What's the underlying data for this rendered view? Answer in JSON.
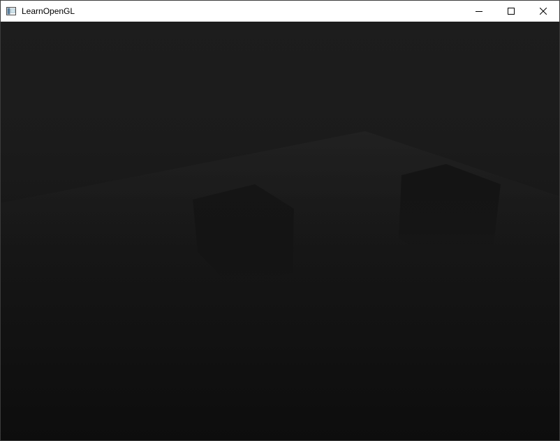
{
  "window": {
    "title": "LearnOpenGL",
    "icons": {
      "app": "app-window-icon",
      "minimize": "minimize-icon",
      "maximize": "maximize-icon",
      "close": "close-icon"
    }
  },
  "scene": {
    "background_color": "#1b1b1b",
    "floor_color": "#1f1f1f",
    "cube_color": "#141414",
    "objects": [
      "floor-plane",
      "cube-left",
      "cube-right"
    ]
  }
}
